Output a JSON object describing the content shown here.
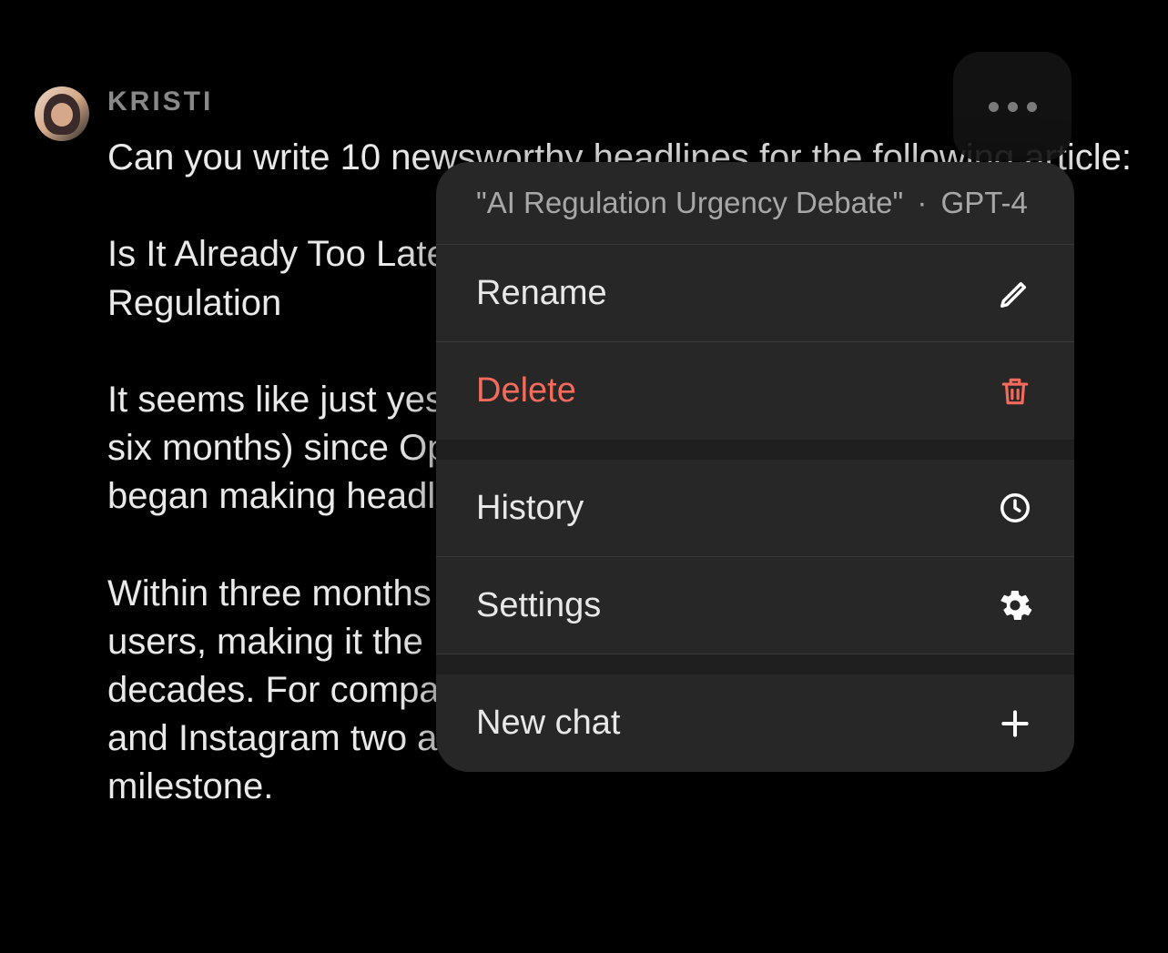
{
  "message": {
    "username": "KRISTI",
    "body": "Can you write 10 newsworthy headlines for the following article:\n\nIs It Already Too Late\nRegulation\n\nIt seems like just yes\nsix months) since Op\nbegan making headl\n\nWithin three months\nusers, making it the\ndecades. For compa.\nand Instagram two and a half years to make the same milestone."
  },
  "popover": {
    "title": "\"AI Regulation Urgency Debate\"",
    "model": "GPT-4",
    "separator": "·",
    "menu": {
      "rename": "Rename",
      "delete": "Delete",
      "history": "History",
      "settings": "Settings",
      "newChat": "New chat"
    }
  }
}
